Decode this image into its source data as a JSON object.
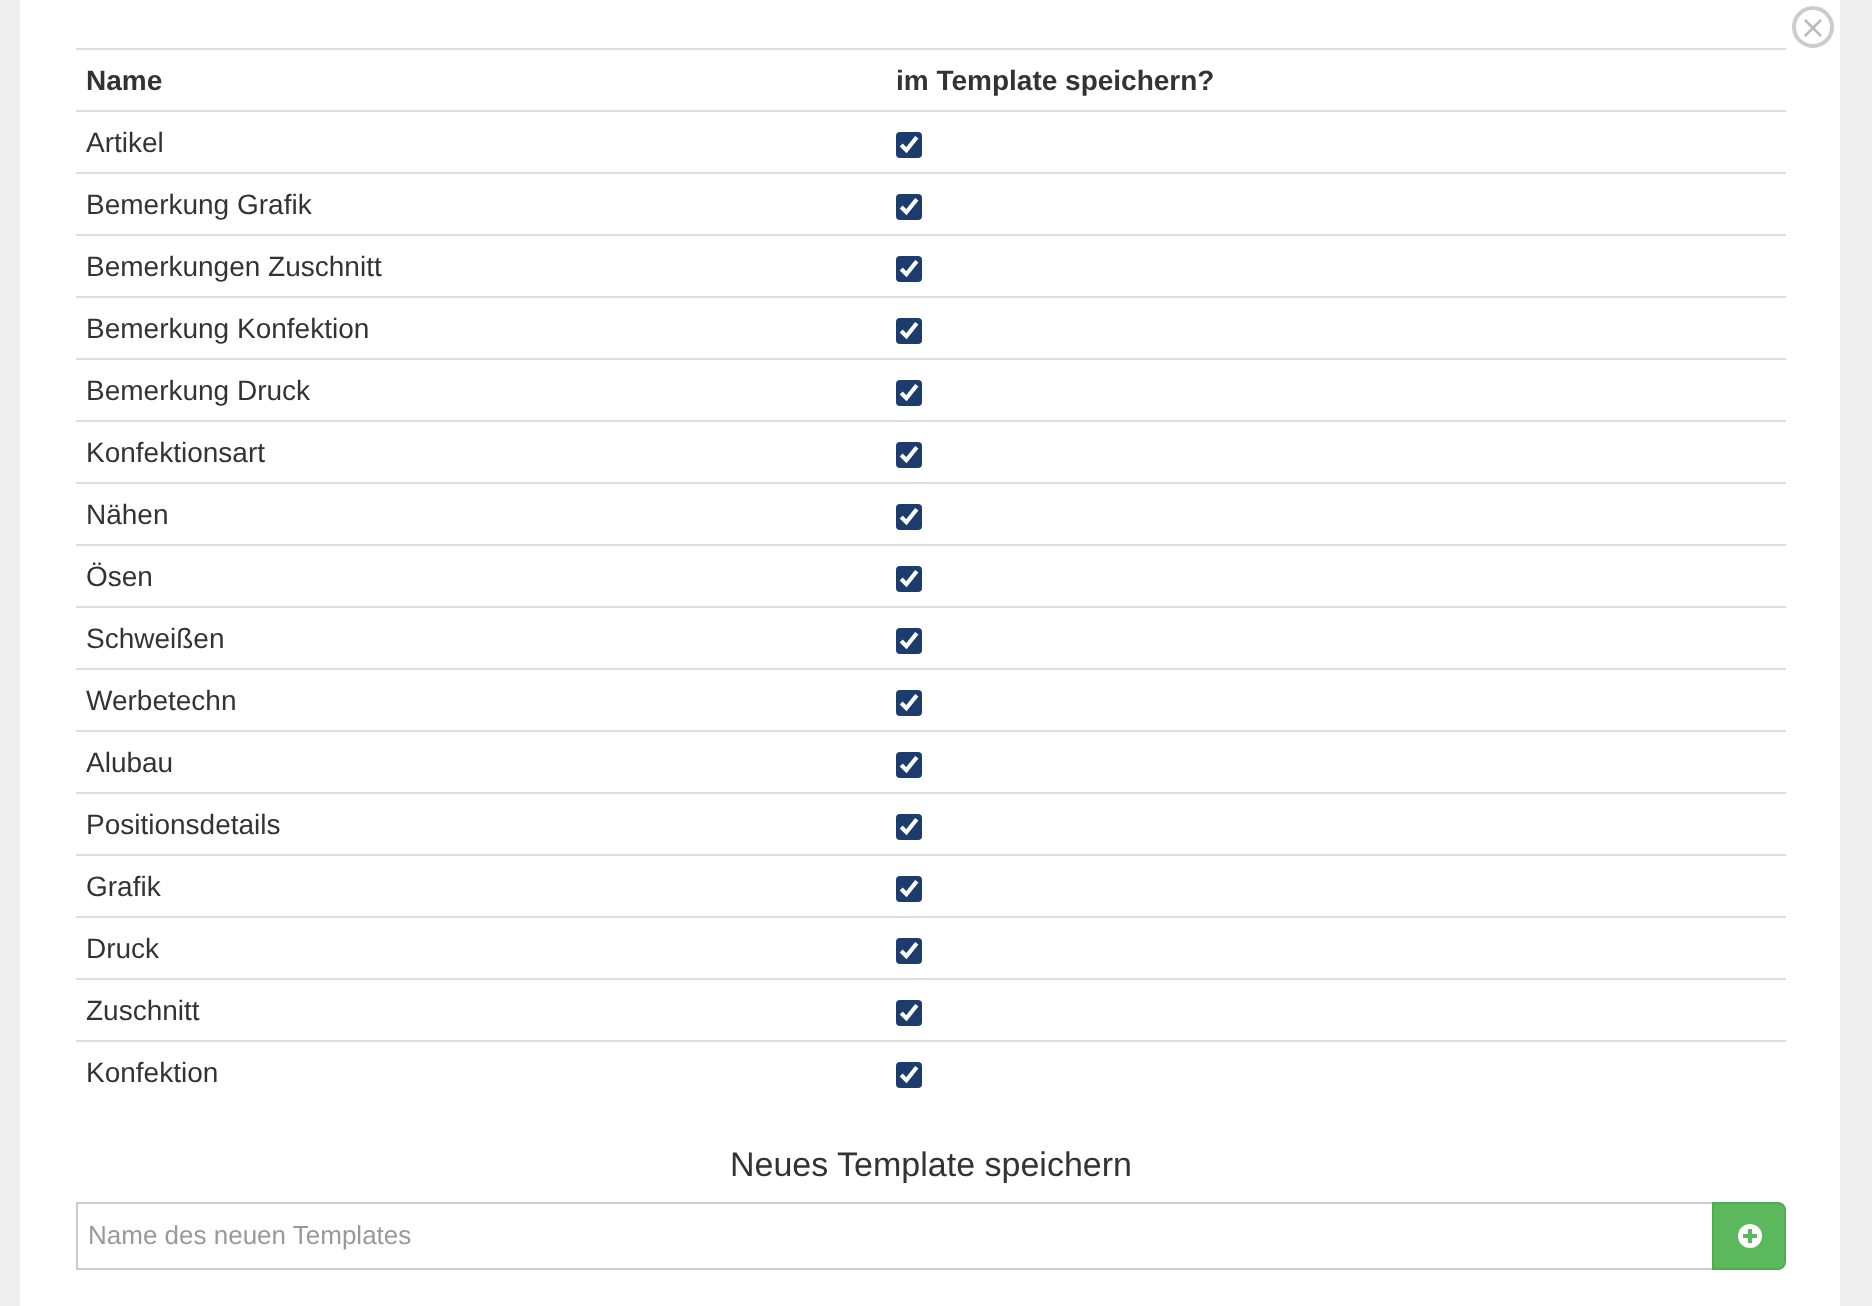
{
  "close_button": {
    "label": "×"
  },
  "table": {
    "columns": [
      "Name",
      "im Template speichern?"
    ],
    "rows": [
      {
        "name": "Artikel",
        "checked": true
      },
      {
        "name": "Bemerkung Grafik",
        "checked": true
      },
      {
        "name": "Bemerkungen Zuschnitt",
        "checked": true
      },
      {
        "name": "Bemerkung Konfektion",
        "checked": true
      },
      {
        "name": "Bemerkung Druck",
        "checked": true
      },
      {
        "name": "Konfektionsart",
        "checked": true
      },
      {
        "name": "Nähen",
        "checked": true
      },
      {
        "name": "Ösen",
        "checked": true
      },
      {
        "name": "Schweißen",
        "checked": true
      },
      {
        "name": "Werbetechn",
        "checked": true
      },
      {
        "name": "Alubau",
        "checked": true
      },
      {
        "name": "Positionsdetails",
        "checked": true
      },
      {
        "name": "Grafik",
        "checked": true
      },
      {
        "name": "Druck",
        "checked": true
      },
      {
        "name": "Zuschnitt",
        "checked": true
      },
      {
        "name": "Konfektion",
        "checked": true
      }
    ]
  },
  "new_template": {
    "title": "Neues Template speichern",
    "placeholder": "Name des neuen Templates"
  }
}
